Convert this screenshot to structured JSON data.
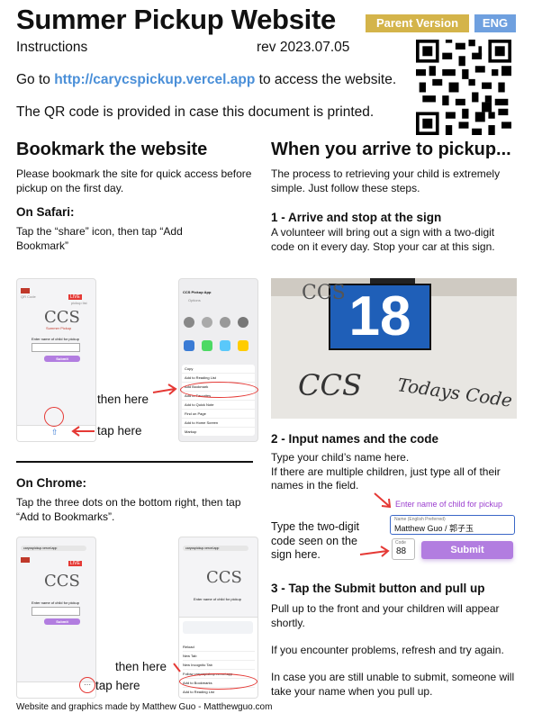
{
  "header": {
    "title": "Summer Pickup Website",
    "badge_parent": "Parent Version",
    "badge_lang": "ENG",
    "subtitle_left": "Instructions",
    "subtitle_right": "rev 2023.07.05"
  },
  "intro": {
    "go_to_prefix": "Go to ",
    "url": "http://carycspickup.vercel.app",
    "go_to_suffix": " to access the website.",
    "qr_note": "The QR code is provided in case this document is printed."
  },
  "bookmark": {
    "heading": "Bookmark the website",
    "description": "Please bookmark the site for quick access before pickup on the first day.",
    "safari_heading": "On Safari:",
    "safari_text": "Tap the “share” icon, then tap “Add Bookmark”",
    "safari_then_here": "then here",
    "safari_tap_here": "tap here",
    "chrome_heading": "On Chrome:",
    "chrome_text": "Tap the three dots on the bottom right, then tap “Add to Bookmarks”.",
    "chrome_then_here": "then here",
    "chrome_tap_here": "tap here"
  },
  "mock_site": {
    "logo_text": "CCS",
    "subtitle": "Summer Pickup",
    "qr_label": "QR Code",
    "live_label": "LIVE",
    "pickup_label": "pickup list",
    "prompt": "Enter name of child for pickup",
    "submit": "Submit",
    "share_title": "CCS Pickup App",
    "share_options": "Options",
    "share_items": [
      "Copy",
      "Add to Reading List",
      "Add Bookmark",
      "Add to Favorites",
      "Add to Quick Note",
      "Find on Page",
      "Add to Home Screen",
      "Markup"
    ],
    "chrome_url": "carycspickup.vercel.app",
    "chrome_menu_items": [
      "Reload",
      "New Tab",
      "New Incognito Tab",
      "Follow carycspickup.vercel.app",
      "Add to Bookmarks",
      "Add to Reading List"
    ]
  },
  "pickup": {
    "heading": "When you arrive to pickup...",
    "description": "The process to retrieving your child is extremely simple. Just follow these steps.",
    "step1_heading": "1 - Arrive and stop at the sign",
    "step1_text": "A volunteer will bring out a sign with a two-digit code on it every day. Stop your car at this sign.",
    "sign_number": "18",
    "sign_ccs": "CCS",
    "sign_todays_code": "Todays Code",
    "step2_heading": "2 - Input names and the code",
    "step2_text1": "Type your child’s name here.",
    "step2_text2": "If there are multiple children, just type all of their names in the field.",
    "step2_code_text": "Type the two-digit code seen on the sign here.",
    "form_prompt": "Enter name of child for pickup",
    "form_name_label": "Name (English Preferred)",
    "form_name_value": "Matthew Guo / 郭子玉",
    "form_code_label": "Code",
    "form_code_value": "88",
    "form_submit": "Submit",
    "step3_heading": "3 - Tap the Submit button and pull up",
    "step3_text1": "Pull up to the front and your children will appear shortly.",
    "step3_text2": "If you encounter problems, refresh and try again.",
    "step3_text3": "In case you are still unable to submit, someone will take your name when you pull up."
  },
  "footer": {
    "text": "Website and graphics made by Matthew Guo - Matthewguo.com"
  },
  "colors": {
    "accent_blue": "#4a8fd8",
    "badge_gold": "#d4b44a",
    "badge_blue": "#6fa0df",
    "submit_purple": "#b27de0",
    "arrow_red": "#e53935"
  }
}
